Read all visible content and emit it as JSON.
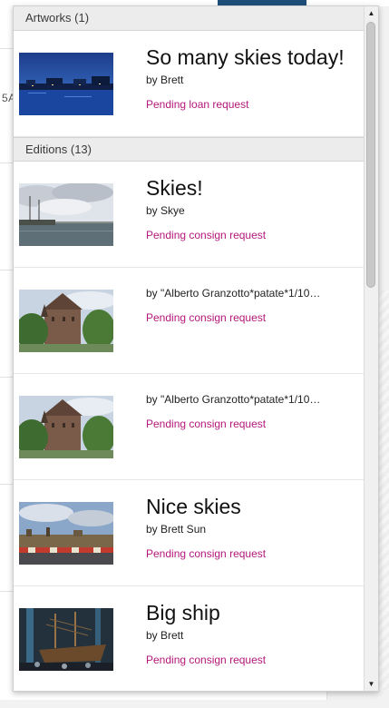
{
  "background": {
    "fragment_text": "5A"
  },
  "dropdown": {
    "sections": [
      {
        "header": "Artworks (1)",
        "items": [
          {
            "title": "So many skies today!",
            "artist": "by Brett",
            "status": "Pending loan request",
            "thumbnail": "night-harbor-photo"
          }
        ]
      },
      {
        "header": "Editions (13)",
        "items": [
          {
            "title": "Skies!",
            "artist": "by Skye",
            "status": "Pending consign request",
            "thumbnail": "harbor-ships-photo"
          },
          {
            "title": "",
            "artist": "by \"Alberto Granzotto*patate*1/10…",
            "status": "Pending consign request",
            "thumbnail": "castle-trees-photo"
          },
          {
            "title": "",
            "artist": "by \"Alberto Granzotto*patate*1/10…",
            "status": "Pending consign request",
            "thumbnail": "castle-trees-photo"
          },
          {
            "title": "Nice skies",
            "artist": "by Brett Sun",
            "status": "Pending consign request",
            "thumbnail": "city-waterfront-photo"
          },
          {
            "title": "Big ship",
            "artist": "by Brett",
            "status": "Pending consign request",
            "thumbnail": "ship-museum-photo"
          }
        ]
      }
    ]
  },
  "colors": {
    "status_text": "#b5177a",
    "header_bg": "#ececec",
    "accent_bar": "#1f4e79"
  }
}
